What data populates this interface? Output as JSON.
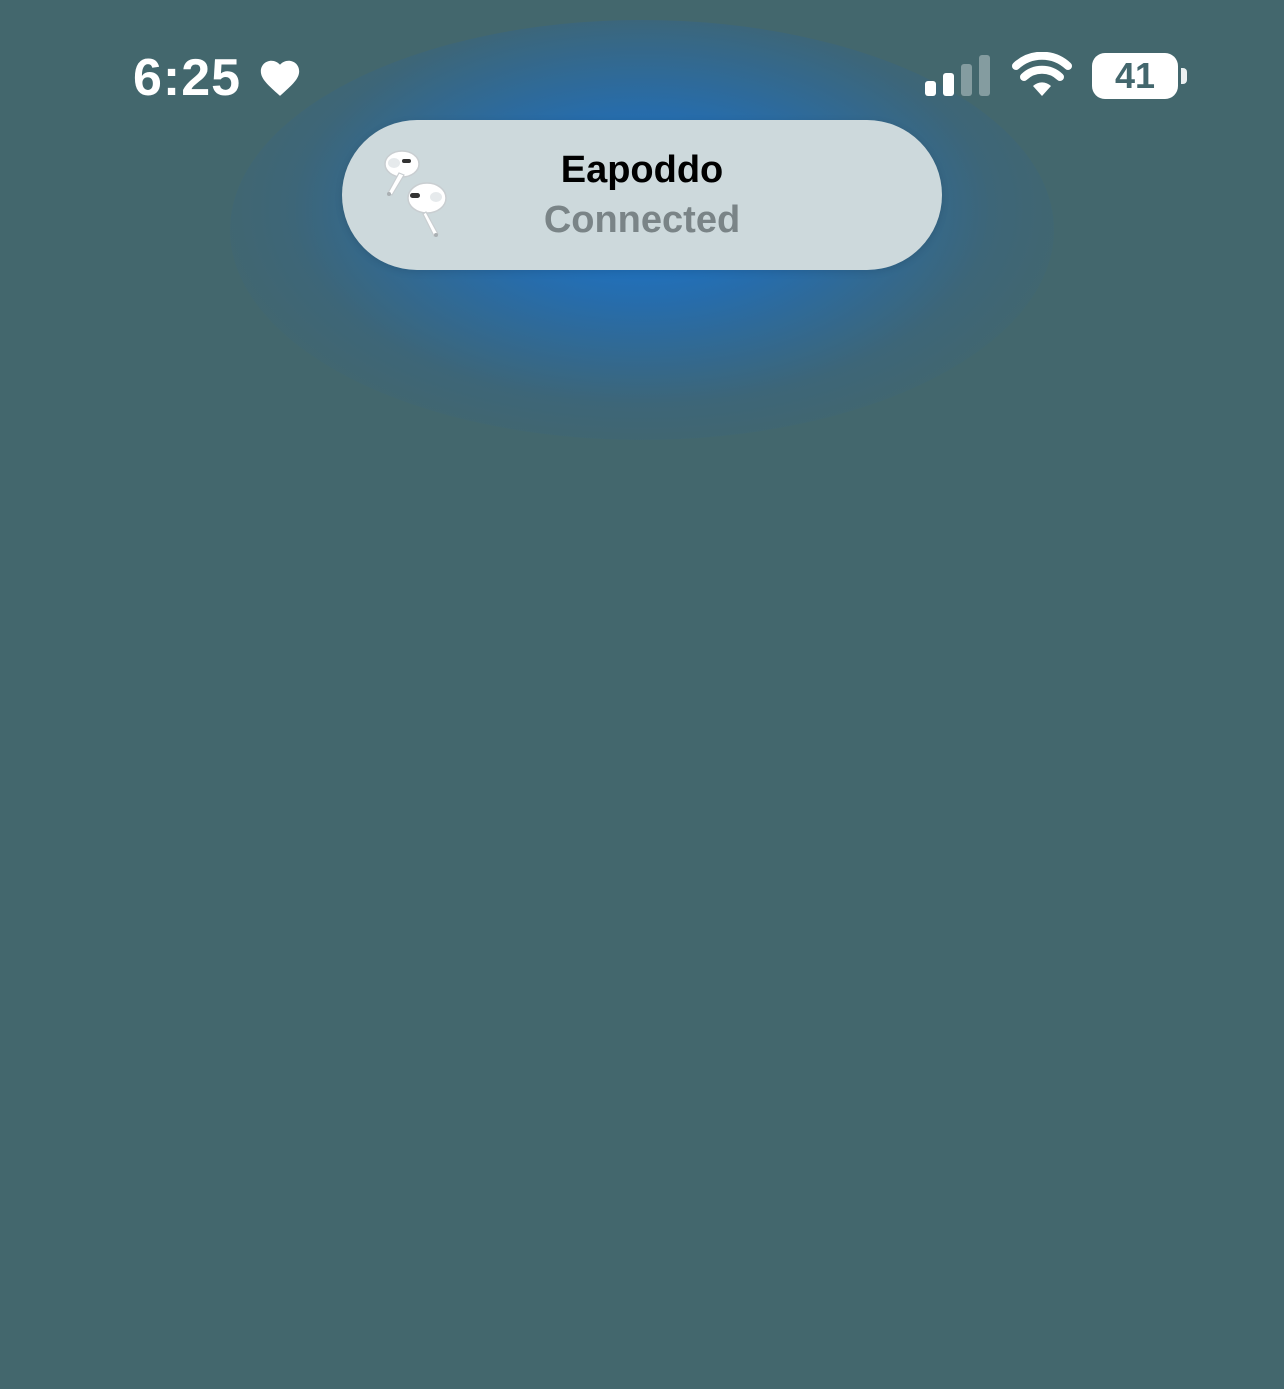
{
  "status_bar": {
    "time": "6:25",
    "time_badge_icon": "heart-icon",
    "cellular_icon": "signal-bars-icon",
    "cellular_bars_active": 2,
    "cellular_bars_total": 4,
    "wifi_icon": "wifi-icon",
    "battery_icon": "battery-icon",
    "battery_level": "41"
  },
  "connection_banner": {
    "device_icon": "airpods-icon",
    "device_name": "Eapoddo",
    "status": "Connected"
  },
  "colors": {
    "background": "#43676d",
    "glow": "#1e78d8",
    "pill": "#cdd9dc",
    "status_text": "#7a8487"
  }
}
